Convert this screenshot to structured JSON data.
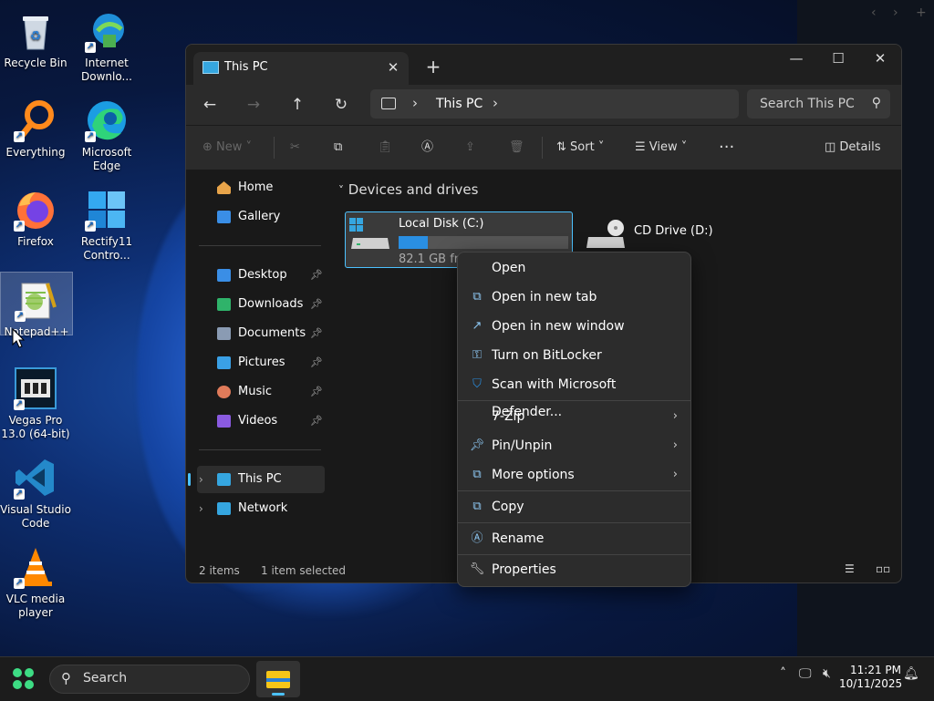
{
  "desktop": {
    "icons": [
      {
        "label": "Recycle Bin",
        "icon": "recycle-bin-icon"
      },
      {
        "label": "Internet Downlo...",
        "icon": "internet-download-manager-icon"
      },
      {
        "label": "Everything",
        "icon": "everything-search-icon"
      },
      {
        "label": "Microsoft Edge",
        "icon": "edge-icon"
      },
      {
        "label": "Firefox",
        "icon": "firefox-icon"
      },
      {
        "label": "Rectify11 Contro...",
        "icon": "rectify11-icon"
      },
      {
        "label": "Notepad++",
        "icon": "notepad-plus-plus-icon"
      },
      {
        "label": "Vegas Pro 13.0 (64-bit)",
        "icon": "vegas-pro-icon"
      },
      {
        "label": "Visual Studio Code",
        "icon": "vscode-icon"
      },
      {
        "label": "VLC media player",
        "icon": "vlc-icon"
      }
    ]
  },
  "explorer": {
    "tab_title": "This PC",
    "address": {
      "crumb": "This PC"
    },
    "search_placeholder": "Search This PC",
    "toolbar": {
      "new": "New",
      "sort": "Sort",
      "view": "View",
      "details": "Details"
    },
    "sidebar": {
      "home": "Home",
      "gallery": "Gallery",
      "pinned": [
        {
          "label": "Desktop",
          "icon": "desktop-folder-icon",
          "color": "#3a8ee6"
        },
        {
          "label": "Downloads",
          "icon": "downloads-folder-icon",
          "color": "#2fb36a"
        },
        {
          "label": "Documents",
          "icon": "documents-folder-icon",
          "color": "#8a9bb3"
        },
        {
          "label": "Pictures",
          "icon": "pictures-folder-icon",
          "color": "#3aa0e6"
        },
        {
          "label": "Music",
          "icon": "music-folder-icon",
          "color": "#e07b5a"
        },
        {
          "label": "Videos",
          "icon": "videos-folder-icon",
          "color": "#8a5ae0"
        }
      ],
      "this_pc": "This PC",
      "network": "Network"
    },
    "section_header": "Devices and drives",
    "drives": [
      {
        "name": "Local Disk (C:)",
        "free": "82.1 GB fr",
        "used_fraction": 0.17
      },
      {
        "name": "CD Drive (D:)"
      }
    ],
    "status": {
      "items": "2 items",
      "selected": "1 item selected"
    }
  },
  "context_menu": {
    "items": [
      {
        "label": "Open",
        "icon": ""
      },
      {
        "label": "Open in new tab",
        "icon": "new-tab-icon"
      },
      {
        "label": "Open in new window",
        "icon": "new-window-icon"
      },
      {
        "label": "Turn on BitLocker",
        "icon": "bitlocker-key-icon"
      },
      {
        "label": "Scan with Microsoft Defender...",
        "icon": "defender-shield-icon"
      },
      {
        "label": "7-Zip",
        "icon": ""
      },
      {
        "label": "Pin/Unpin",
        "icon": "pin-icon"
      },
      {
        "label": "More options",
        "icon": "more-options-icon"
      },
      {
        "label": "Copy",
        "icon": "copy-icon"
      },
      {
        "label": "Rename",
        "icon": "rename-icon"
      },
      {
        "label": "Properties",
        "icon": "properties-wrench-icon"
      }
    ]
  },
  "taskbar": {
    "search_label": "Search",
    "time": "11:21 PM",
    "date": "10/11/2025"
  },
  "colors": {
    "accent": "#4cc2ff",
    "drive_bar": "#2a8fe3",
    "window_bg": "#191919"
  }
}
